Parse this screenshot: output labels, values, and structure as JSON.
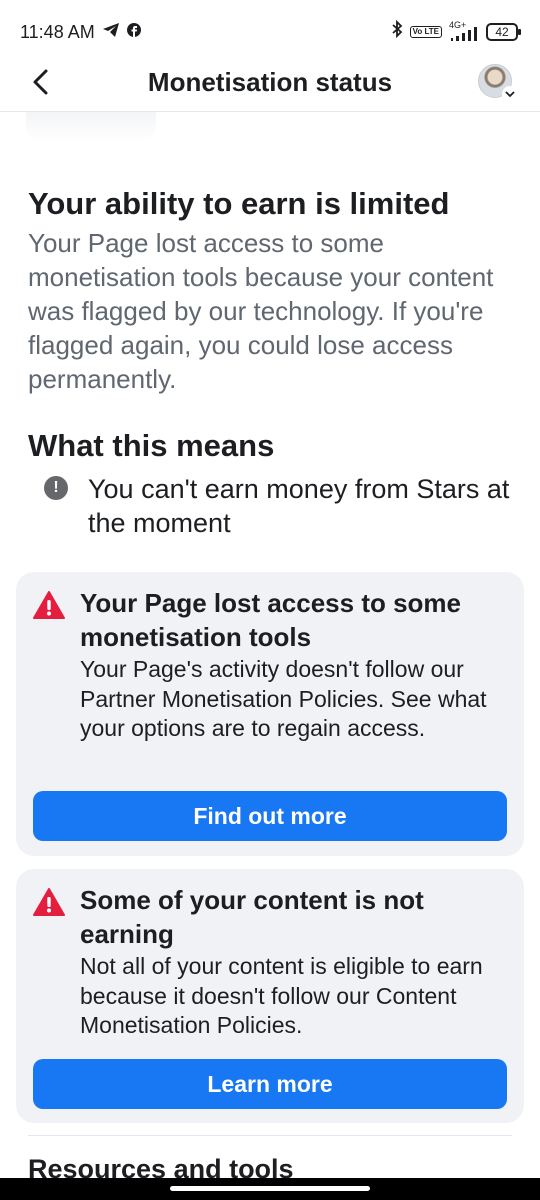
{
  "status_bar": {
    "time": "11:48 AM",
    "network": "4G+",
    "volte": "Vo LTE",
    "battery": "42"
  },
  "header": {
    "title": "Monetisation status"
  },
  "main": {
    "limit_title": "Your ability to earn is limited",
    "limit_description": "Your Page lost access to some monetisation tools because your content was flagged by our technology. If you're flagged again, you could lose access permanently.",
    "means_title": "What this means",
    "means_items": [
      {
        "text": "You can't earn money from Stars at the moment"
      }
    ]
  },
  "cards": [
    {
      "title": "Your Page lost access to some monetisation tools",
      "description": "Your Page's activity doesn't follow our Partner Monetisation Policies. See what your options are to regain access.",
      "button_label": "Find out more"
    },
    {
      "title": "Some of your content is not earning",
      "description": "Not all of your content is eligible to earn because it doesn't follow our Content Monetisation Policies.",
      "button_label": "Learn more"
    }
  ],
  "resources": {
    "title": "Resources and tools"
  },
  "colors": {
    "primary": "#1877f2",
    "warning": "#e41e3f",
    "card_bg": "#f0f2f5",
    "secondary_text": "#606770"
  }
}
